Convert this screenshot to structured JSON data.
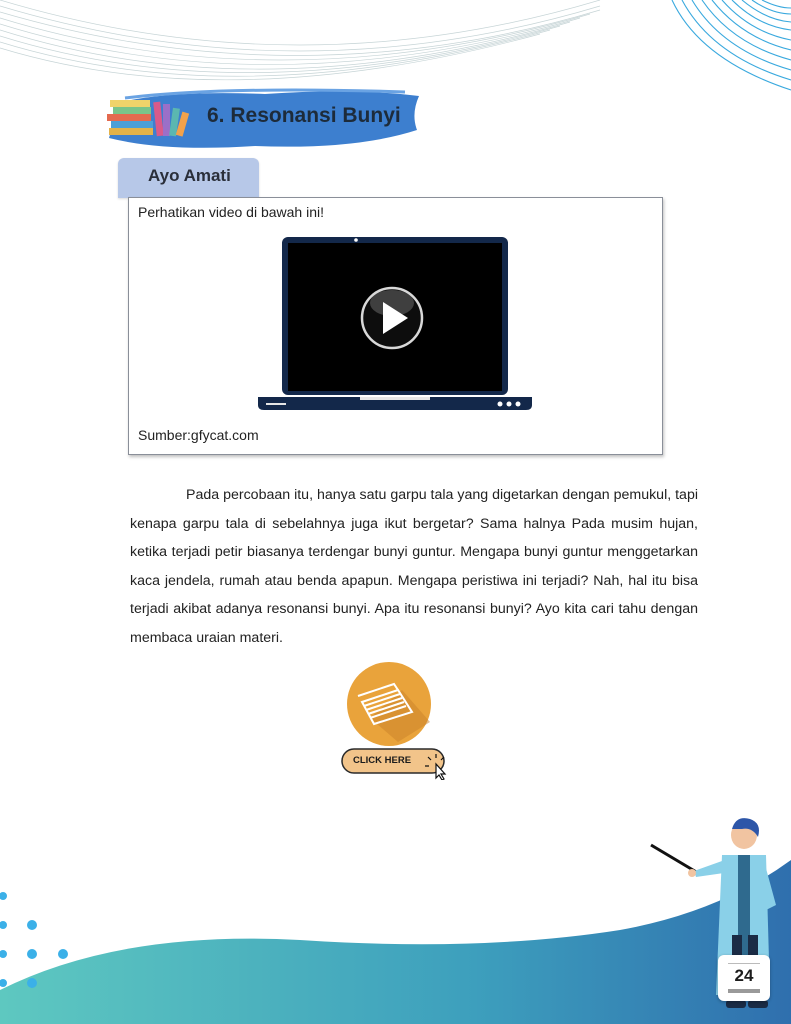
{
  "section": {
    "title": "6. Resonansi Bunyi"
  },
  "activity": {
    "tab_label": "Ayo Amati"
  },
  "video": {
    "instruction": "Perhatikan video di bawah ini!",
    "source": "Sumber:gfycat.com"
  },
  "paragraph": {
    "text": "Pada percobaan itu, hanya satu garpu tala yang digetarkan dengan pemukul, tapi kenapa garpu tala di sebelahnya juga ikut bergetar? Sama halnya Pada musim hujan, ketika terjadi petir biasanya terdengar bunyi guntur. Mengapa bunyi guntur menggetarkan kaca jendela, rumah atau benda apapun.  Mengapa peristiwa ini terjadi? Nah, hal itu bisa terjadi akibat adanya resonansi bunyi. Apa itu resonansi bunyi? Ayo kita cari tahu dengan membaca uraian materi."
  },
  "materi_button": {
    "label": "CLICK HERE"
  },
  "page": {
    "number": "24"
  },
  "colors": {
    "wave_dark": "#2f86b5",
    "wave_light": "#5ec8c0",
    "banner": "#3d7fcf",
    "tab": "#b7c8e8",
    "button_orange": "#e9a33b"
  }
}
